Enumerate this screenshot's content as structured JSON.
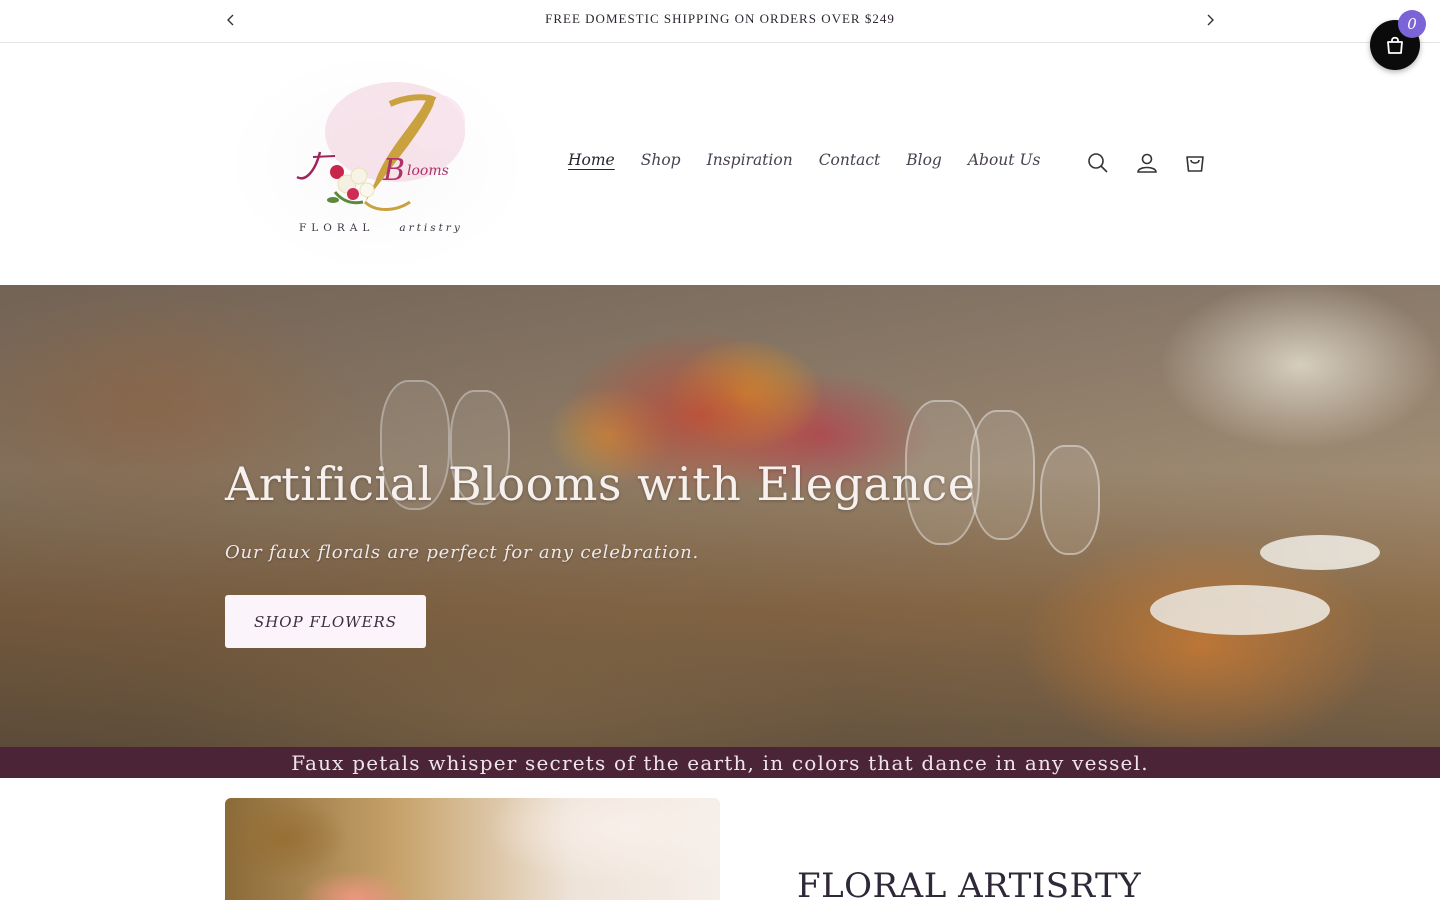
{
  "announcement": {
    "text": "FREE DOMESTIC SHIPPING ON ORDERS OVER $249",
    "prev_icon": "chevron-left-icon",
    "next_icon": "chevron-right-icon"
  },
  "floating_cart": {
    "icon": "shopping-bag-icon",
    "count": "0",
    "badge_color": "#7b63d8"
  },
  "logo": {
    "tagline_1": "FLORAL",
    "tagline_2": "artistry"
  },
  "nav": {
    "items": [
      {
        "label": "Home",
        "active": true
      },
      {
        "label": "Shop",
        "active": false
      },
      {
        "label": "Inspiration",
        "active": false
      },
      {
        "label": "Contact",
        "active": false
      },
      {
        "label": "Blog",
        "active": false
      },
      {
        "label": "About Us",
        "active": false
      }
    ]
  },
  "header_icons": [
    "search-icon",
    "account-icon",
    "cart-icon"
  ],
  "hero": {
    "title": "Artificial Blooms with Elegance",
    "subtitle": "Our faux florals are perfect for any celebration.",
    "button_label": "SHOP FLOWERS"
  },
  "ribbon": {
    "text": "Faux petals whisper secrets of the earth, in colors that dance in any vessel.",
    "color": "#4b2537"
  },
  "feature": {
    "title": "FLORAL ARTISRTY"
  }
}
